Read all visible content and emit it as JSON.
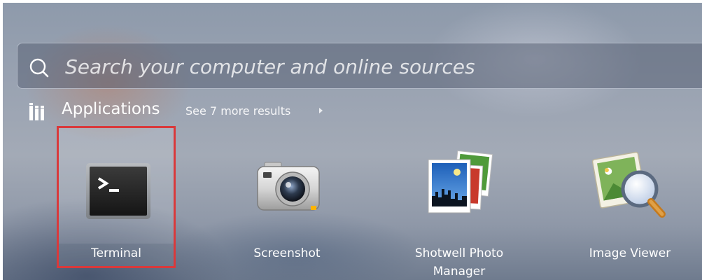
{
  "search": {
    "placeholder": "Search your computer and online sources",
    "icon": "search-icon"
  },
  "category": {
    "icon": "applications-category-icon",
    "title": "Applications",
    "see_more": "See 7 more results"
  },
  "apps": [
    {
      "label": "Terminal",
      "icon": "terminal-icon",
      "selected": true
    },
    {
      "label": "Screenshot",
      "icon": "camera-icon",
      "selected": false
    },
    {
      "label": "Shotwell Photo Manager",
      "icon": "photos-icon",
      "selected": false
    },
    {
      "label": "Image Viewer",
      "icon": "image-viewer-icon",
      "selected": false
    }
  ],
  "colors": {
    "selection_outline": "#d9393b",
    "text": "#ffffff"
  }
}
